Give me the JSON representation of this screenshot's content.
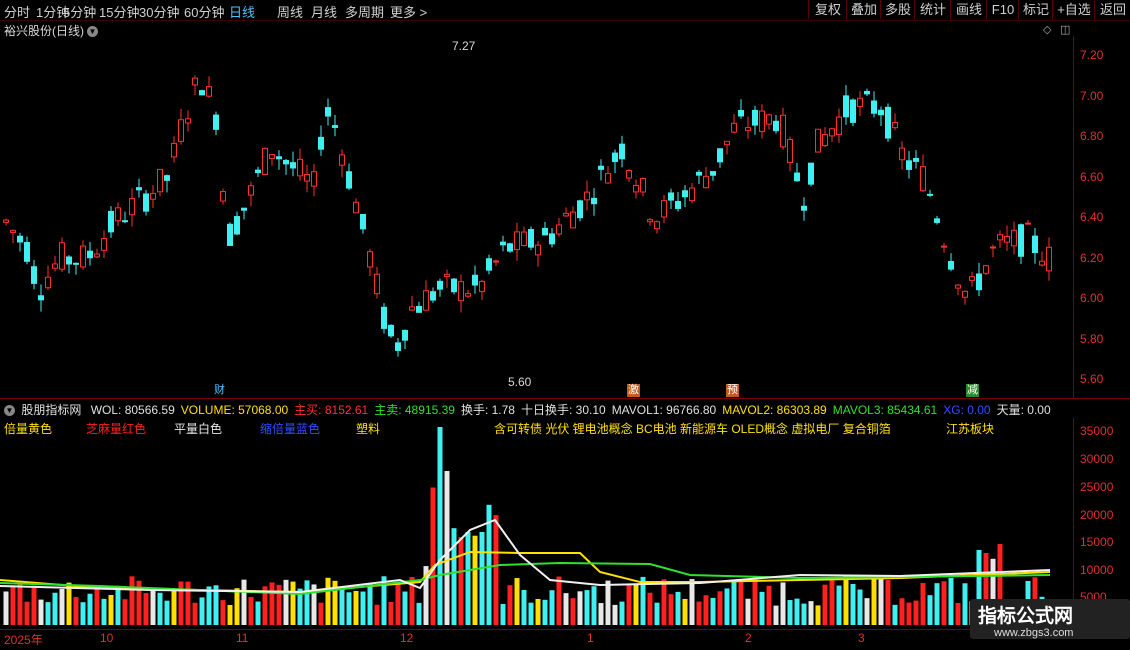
{
  "toolbar": {
    "periods": [
      "分时",
      "1分钟",
      "5分钟",
      "15分钟",
      "30分钟",
      "60分钟",
      "日线",
      "周线",
      "月线",
      "多周期",
      "更多 >"
    ],
    "active_period": "日线",
    "actions": [
      "复权",
      "叠加",
      "多股",
      "统计",
      "画线",
      "F10",
      "标记",
      "+自选",
      "返回"
    ]
  },
  "stock": {
    "title": "裕兴股份(日线)"
  },
  "price_chart": {
    "yticks": [
      "7.20",
      "7.00",
      "6.80",
      "6.60",
      "6.40",
      "6.20",
      "6.00",
      "5.80",
      "5.60"
    ],
    "high_label": "7.27",
    "low_label": "5.60",
    "events": [
      "财",
      "激",
      "预",
      "减"
    ]
  },
  "indicator": {
    "name": "股朋指标网",
    "values": [
      {
        "text": "WOL: 80566.59",
        "color": "#e0e0e0"
      },
      {
        "text": "VOLUME: 57068.00",
        "color": "#ffe000"
      },
      {
        "text": "主买: 8152.61",
        "color": "#ff3030"
      },
      {
        "text": "主卖: 48915.39",
        "color": "#30e030"
      },
      {
        "text": "换手: 1.78",
        "color": "#e0e0e0"
      },
      {
        "text": "十日换手: 30.10",
        "color": "#e0e0e0"
      },
      {
        "text": "MAVOL1: 96766.80",
        "color": "#e0e0e0"
      },
      {
        "text": "MAVOL2: 86303.89",
        "color": "#ffe000"
      },
      {
        "text": "MAVOL3: 85434.61",
        "color": "#30e030"
      },
      {
        "text": "XG: 0.00",
        "color": "#3050ff"
      },
      {
        "text": "天量: 0.00",
        "color": "#e0e0e0"
      }
    ],
    "categories": [
      {
        "text": "倍量黄色",
        "color": "#ffe000"
      },
      {
        "text": "芝麻量红色",
        "color": "#ff2020"
      },
      {
        "text": "平量白色",
        "color": "#e8e8e8"
      },
      {
        "text": "缩倍量蓝色",
        "color": "#3050ff"
      },
      {
        "text": "塑料",
        "color": "#ffe000"
      },
      {
        "text": "含可转债 光伏 锂电池概念 BC电池 新能源车 OLED概念 虚拟电厂 复合铜箔",
        "color": "#ffe000"
      },
      {
        "text": "江苏板块",
        "color": "#ffe000"
      }
    ],
    "yticks": [
      "35000",
      "30000",
      "25000",
      "20000",
      "15000",
      "10000",
      "5000"
    ]
  },
  "dates": [
    "2025年",
    "10",
    "11",
    "12",
    "1",
    "2",
    "3"
  ],
  "watermark": {
    "line1": "指标公式网",
    "line2": "www.zbgs3.com"
  },
  "colors": {
    "up": "#ff3030",
    "down": "#40f0f0",
    "axis": "#e03030"
  }
}
